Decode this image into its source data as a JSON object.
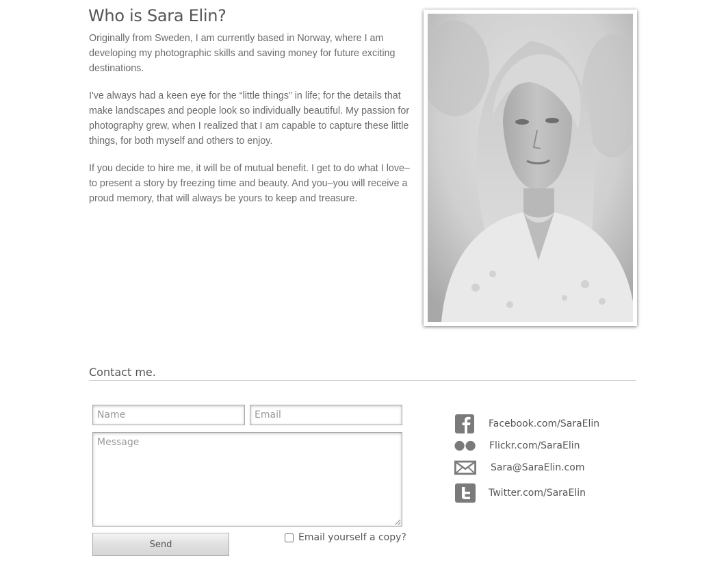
{
  "about": {
    "heading": "Who is Sara Elin?",
    "paragraphs": [
      "Originally from Sweden, I am currently based in Norway, where I am developing my photographic skills and saving money for future exciting destinations.",
      "I've always had a keen eye for the “little things” in life; for the details that make landscapes and people look so individually beautiful. My passion for photography grew, when I realized that I am capable to capture these little things, for both myself and others to enjoy.",
      "If you decide to hire me, it will be of mutual benefit. I get to do what I love–to present a story by freezing time and beauty. And you–you will receive a proud memory, that will always be yours to keep and treasure."
    ]
  },
  "contact": {
    "heading": "Contact me.",
    "name_placeholder": "Name",
    "email_placeholder": "Email",
    "message_placeholder": "Message",
    "send_label": "Send",
    "copy_label": "Email yourself a copy?"
  },
  "social": {
    "items": [
      {
        "label": "Facebook.com/SaraElin",
        "icon": "facebook-icon"
      },
      {
        "label": "Flickr.com/SaraElin",
        "icon": "flickr-icon"
      },
      {
        "label": "Sara@SaraElin.com",
        "icon": "mail-icon"
      },
      {
        "label": "Twitter.com/SaraElin",
        "icon": "twitter-icon"
      }
    ]
  },
  "colors": {
    "text": "#666666",
    "icon": "#7a7a7a",
    "rule": "#cccccc"
  }
}
